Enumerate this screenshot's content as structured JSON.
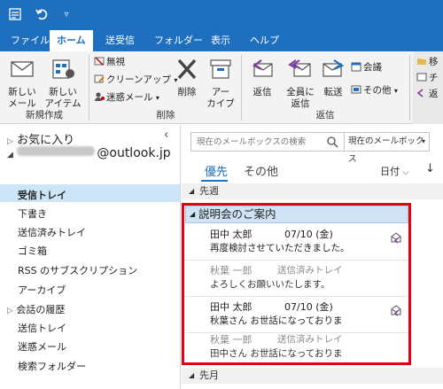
{
  "ribbon_tabs": [
    "ファイル",
    "ホーム",
    "送受信",
    "フォルダー",
    "表示",
    "ヘルプ"
  ],
  "ribbon": {
    "new_mail": "新しい\nメール",
    "new_item": "新しい\nアイテム",
    "group_new": "新規作成",
    "ignore": "無視",
    "cleanup": "クリーンアップ",
    "junk": "迷惑メール",
    "delete": "削除",
    "archive": "アー\nカイブ",
    "group_delete": "削除",
    "reply": "返信",
    "reply_all": "全員に\n返信",
    "forward": "転送",
    "meeting": "会議",
    "more": "その他",
    "group_reply": "返信",
    "move_partial": "移",
    "team_partial": "チ",
    "reply_partial": "返"
  },
  "folders": {
    "favorites": "お気に入り",
    "account_suffix": "@outlook.jp",
    "items": [
      "受信トレイ",
      "下書き",
      "送信済みトレイ",
      "ゴミ箱",
      "RSS のサブスクリプション",
      "アーカイブ",
      "会話の履歴",
      "送信トレイ",
      "迷惑メール",
      "検索フォルダー"
    ]
  },
  "search": {
    "placeholder": "現在のメールボックスの検索",
    "scope": "現在のメールボックス"
  },
  "view_tabs": {
    "focused": "優先",
    "other": "その他"
  },
  "sort": {
    "by": "日付",
    "dir": "↓"
  },
  "groups": {
    "last_week": "先週",
    "last_month": "先月"
  },
  "conversation": {
    "subject": "説明会のご案内",
    "messages": [
      {
        "from": "田中 太郎",
        "date": "07/10 (金)",
        "snippet": "再度検討させていただきました。"
      },
      {
        "from": "秋葉 一郎",
        "folder": "送信済みトレイ",
        "snippet": "よろしくお願いいたします。"
      },
      {
        "from": "田中 太郎",
        "date": "07/10 (金)",
        "snippet": "秋葉さん お世話になっておりま"
      },
      {
        "from": "秋葉 一郎",
        "folder": "送信済みトレイ",
        "snippet": "田中さん お世話になっておりま"
      }
    ]
  },
  "colors": {
    "accent": "#1e6fbf",
    "highlight": "#e60012",
    "selection": "#cde6f7"
  }
}
